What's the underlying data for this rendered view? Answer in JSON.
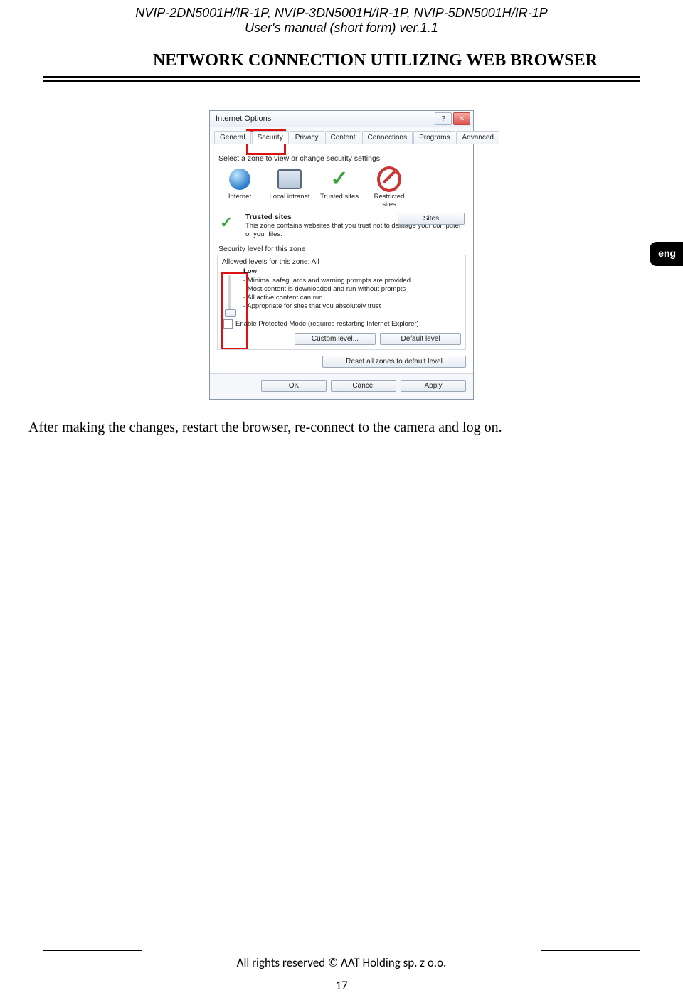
{
  "header": {
    "line1": "NVIP-2DN5001H/IR-1P, NVIP-3DN5001H/IR-1P, NVIP-5DN5001H/IR-1P",
    "line2": "User's manual (short form) ver.1.1"
  },
  "section_title": "NETWORK CONNECTION UTILIZING WEB BROWSER",
  "side_tab": "eng",
  "dialog": {
    "title": "Internet Options",
    "help_glyph": "?",
    "close_glyph": "✕",
    "tabs": [
      "General",
      "Security",
      "Privacy",
      "Content",
      "Connections",
      "Programs",
      "Advanced"
    ],
    "active_tab_index": 1,
    "zone_prompt": "Select a zone to view or change security settings.",
    "zones": [
      {
        "name": "Internet"
      },
      {
        "name": "Local intranet"
      },
      {
        "name": "Trusted sites"
      },
      {
        "name": "Restricted sites"
      }
    ],
    "trusted": {
      "title": "Trusted sites",
      "desc": "This zone contains websites that you trust not to damage your computer or your files.",
      "sites_btn": "Sites"
    },
    "sec_label": "Security level for this zone",
    "allowed": "Allowed levels for this zone: All",
    "level_name": "Low",
    "bullets": [
      "- Minimal safeguards and warning prompts are provided",
      "- Most content is downloaded and run without prompts",
      "- All active content can run",
      "- Appropriate for sites that you absolutely trust"
    ],
    "epm": "Enable Protected Mode (requires restarting Internet Explorer)",
    "custom_btn": "Custom level...",
    "default_btn": "Default level",
    "reset_btn": "Reset all zones to default level",
    "ok": "OK",
    "cancel": "Cancel",
    "apply": "Apply"
  },
  "body_text": "After making the changes, restart the browser, re-connect to the camera and log on.",
  "footer": "All rights reserved © AAT Holding sp. z o.o.",
  "page_num": "17"
}
